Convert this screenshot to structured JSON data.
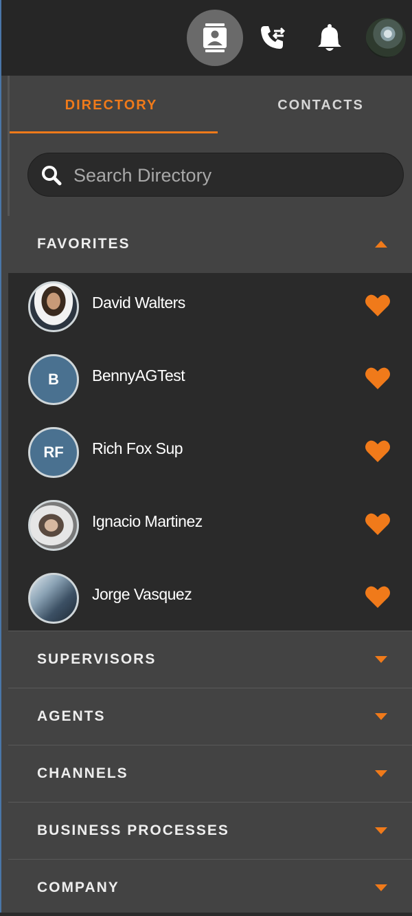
{
  "top_bar": {
    "icons": [
      "contacts-book-icon",
      "call-transfer-icon",
      "bell-icon"
    ],
    "avatar": "user-avatar"
  },
  "tabs": [
    {
      "label": "DIRECTORY",
      "active": true
    },
    {
      "label": "CONTACTS",
      "active": false
    }
  ],
  "search": {
    "placeholder": "Search Directory",
    "value": ""
  },
  "favorites": {
    "title": "FAVORITES",
    "expanded": true,
    "items": [
      {
        "name": "David Walters",
        "initials": "",
        "photo": true
      },
      {
        "name": "BennyAGTest",
        "initials": "B",
        "photo": false
      },
      {
        "name": "Rich Fox Sup",
        "initials": "RF",
        "photo": false
      },
      {
        "name": "Ignacio Martinez",
        "initials": "",
        "photo": true
      },
      {
        "name": "Jorge Vasquez",
        "initials": "",
        "photo": true
      }
    ]
  },
  "sections": [
    {
      "title": "SUPERVISORS",
      "expanded": false
    },
    {
      "title": "AGENTS",
      "expanded": false
    },
    {
      "title": "CHANNELS",
      "expanded": false
    },
    {
      "title": "BUSINESS PROCESSES",
      "expanded": false
    },
    {
      "title": "COMPANY",
      "expanded": false
    }
  ],
  "colors": {
    "accent": "#f07a1a",
    "background": "#434343",
    "topbar": "#262626",
    "list_bg": "#2a2a2a",
    "initials_avatar": "#4a7190"
  }
}
